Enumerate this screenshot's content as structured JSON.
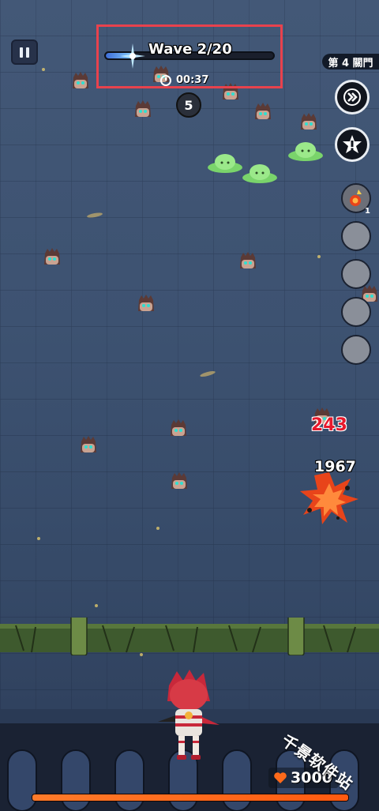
{
  "hud": {
    "pause_icon": "pause-icon",
    "wave_label": "Wave 2/20",
    "wave_progress": 0.17,
    "timer": "00:37",
    "combo": "5",
    "gate_label": "第 4 關門"
  },
  "right_panel": {
    "fast_forward_icon": "fast-forward-icon",
    "auto_skill_icon": "auto-skill-icon",
    "skills": [
      {
        "icon": "fire-skill-icon",
        "count": "1"
      },
      {
        "icon": "empty-slot"
      },
      {
        "icon": "empty-slot"
      },
      {
        "icon": "empty-slot"
      },
      {
        "icon": "empty-slot"
      }
    ]
  },
  "combat": {
    "damage_red": "243",
    "damage_white": "1967"
  },
  "player": {
    "hp": "3000",
    "hp_fraction": 1.0
  },
  "watermark": "千景软件站",
  "colors": {
    "highlight": "#e8424d",
    "hp": "#ff6a1a",
    "wave_fill": "#5aa0ff",
    "damage_red": "#e8192c"
  }
}
